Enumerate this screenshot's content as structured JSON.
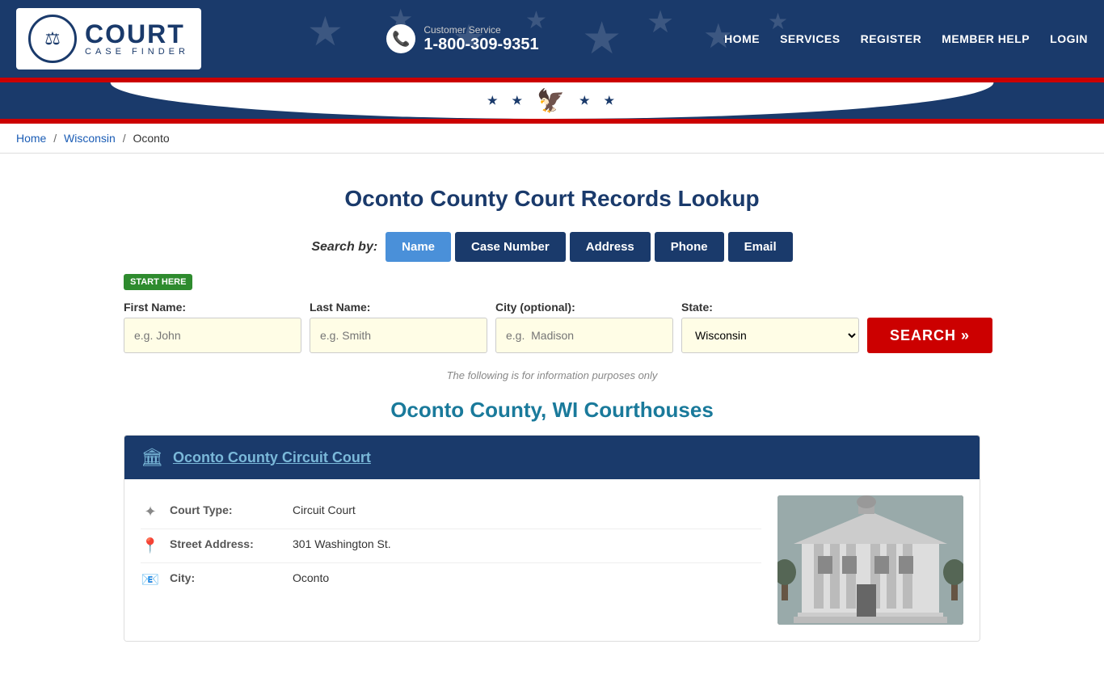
{
  "header": {
    "logo_title": "COURT",
    "logo_subtitle": "CASE FINDER",
    "cs_label": "Customer Service",
    "cs_phone": "1-800-309-9351",
    "nav": [
      {
        "label": "HOME",
        "id": "nav-home"
      },
      {
        "label": "SERVICES",
        "id": "nav-services"
      },
      {
        "label": "REGISTER",
        "id": "nav-register"
      },
      {
        "label": "MEMBER HELP",
        "id": "nav-member-help"
      },
      {
        "label": "LOGIN",
        "id": "nav-login"
      }
    ]
  },
  "breadcrumb": {
    "home": "Home",
    "state": "Wisconsin",
    "current": "Oconto"
  },
  "page": {
    "title": "Oconto County Court Records Lookup",
    "search_by_label": "Search by:",
    "search_tabs": [
      {
        "label": "Name",
        "active": true
      },
      {
        "label": "Case Number",
        "active": false
      },
      {
        "label": "Address",
        "active": false
      },
      {
        "label": "Phone",
        "active": false
      },
      {
        "label": "Email",
        "active": false
      }
    ],
    "start_here": "START HERE",
    "fields": {
      "first_name_label": "First Name:",
      "first_name_placeholder": "e.g. John",
      "last_name_label": "Last Name:",
      "last_name_placeholder": "e.g. Smith",
      "city_label": "City (optional):",
      "city_placeholder": "e.g.  Madison",
      "state_label": "State:",
      "state_value": "Wisconsin"
    },
    "search_button": "SEARCH »",
    "info_note": "The following is for information purposes only",
    "courthouses_title": "Oconto County, WI Courthouses",
    "court_card": {
      "name": "Oconto County Circuit Court",
      "court_type_label": "Court Type:",
      "court_type_value": "Circuit Court",
      "address_label": "Street Address:",
      "address_value": "301 Washington St.",
      "city_label": "City:",
      "city_value": "Oconto"
    }
  }
}
